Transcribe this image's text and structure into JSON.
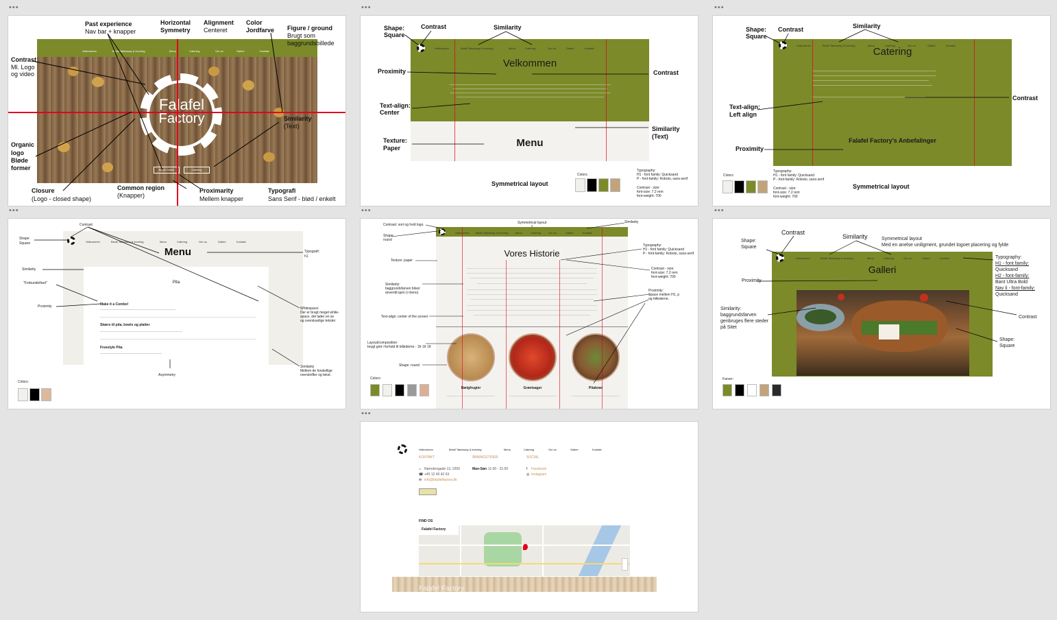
{
  "board": {
    "background": "#e4e4e4",
    "frame_menu": "•••"
  },
  "colors": {
    "olive": "#7c8a2a",
    "white": "#ffffff",
    "offwhite": "#f1f0ec",
    "black": "#000000",
    "tan": "#c2a37b",
    "grey": "#9a9a9a",
    "peach": "#dcae98",
    "dark": "#2a2a2a",
    "red": "#e2001a"
  },
  "frame1": {
    "past_experience_title": "Past experience",
    "past_experience_sub": "Nav bar + knapper",
    "horizontal_title": "Horizontal",
    "horizontal_sub": "Symmetry",
    "alignment_title": "Alignment",
    "alignment_sub": "Centeret",
    "color_title": "Color",
    "color_sub": "Jordfarve",
    "figure_title": "Figure / ground",
    "figure_sub1": "Brugt som",
    "figure_sub2": "baggrundsbillede",
    "contrast_title": "Contrast",
    "contrast_sub1": "Ml. Logo",
    "contrast_sub2": "og video",
    "organic_1": "Organic",
    "organic_2": "logo",
    "organic_3": "Bløde",
    "organic_4": "former",
    "similarity_title": "Similarity",
    "similarity_sub": "(Text)",
    "closure_title": "Closure",
    "closure_sub": "(Logo  - closed shape)",
    "common_title": "Common region",
    "common_sub": "(Knapper)",
    "proximity_title": "Proximarity",
    "proximity_sub": "Mellem knapper",
    "typografi_title": "Typografi",
    "typografi_sub": "Sans Serif - blød / enkelt",
    "nav": [
      "Velkommen",
      "Bestil Takeaway & levering",
      "Menu",
      "Catering",
      "Om os",
      "Galleri",
      "Kontakt"
    ],
    "logo_line1": "Falafel",
    "logo_line2": "Factory",
    "btn_left": "Bestil Online",
    "btn_right": "Catering"
  },
  "frame2": {
    "shape": "Shape:",
    "square": "Square",
    "contrast": "Contrast",
    "similarity": "Similarity",
    "proximity": "Proximity",
    "contrast_right": "Contrast",
    "text_align": "Text-align:",
    "center": "Center",
    "similarity_text1": "Similarity",
    "similarity_text2": "(Text)",
    "texture": "Texture:",
    "paper": "Paper",
    "heading": "Velkommen",
    "menu_heading": "Menu",
    "symmetrical": "Symmetrical layout",
    "colors_label": "Colors:",
    "typo_1": "Typography:",
    "typo_2": "H1 - font family: Quicksand",
    "typo_3": "P - font-family: Roboto, sans-serif",
    "typo_4": "Contrast - size:",
    "typo_5": "font-size: 7.2 rem",
    "typo_6": "font-weight: 700"
  },
  "frame3": {
    "shape": "Shape:",
    "square": "Square",
    "contrast": "Contrast",
    "similarity": "Similarity",
    "heading": "Catering",
    "contrast_right": "Contrast",
    "text_align": "Text-align:",
    "left_align": "Left align",
    "proximity": "Proximity",
    "sub_heading": "Falafel Factory's Anbefalinger",
    "colors_label": "Colors:",
    "symmetrical": "Symmetrical layout",
    "typo_1": "Typography:",
    "typo_2": "H1 - font family: Quicksand",
    "typo_3": "P - font-family: Roboto, sans-serif",
    "typo_4": "Contrast - size:",
    "typo_5": "font-size: 7.2 rem",
    "typo_6": "font-weight: 700"
  },
  "frame4": {
    "contrast": "Contrast",
    "shape": "Shape:",
    "square": "Square",
    "heading": "Menu",
    "typografi": "Typografi:",
    "h1": "h1",
    "similarity": "Similarity",
    "forbundethed": "\"Forbundethed\"",
    "proximity": "Proximity",
    "pita": "Pita",
    "item1": "Make it a Combo!",
    "item2": "Skærs til pita, bowls og platter",
    "item3": "Freestyle Pita",
    "whitespace_1": "Whitespace:",
    "whitespace_2": "Der er brugt meget white-",
    "whitespace_3": "space, det lader en se",
    "whitespace_4": "og overskuelige tekster",
    "similarity_2": "Similarity",
    "similarity_3": "Mellem de forskellige",
    "similarity_4": "overskrifter og tekst.",
    "asymmetry": "Asymmetry",
    "colors_label": "Colors:"
  },
  "frame5": {
    "contrast": "Contrast: sort og hvid logo.",
    "symmetrical": "Symmetrical layout",
    "similarity": "Similarity",
    "shape": "Shape:",
    "round": "round",
    "heading": "Vores Historie",
    "typo_1": "Typography:",
    "typo_2": "H1 - font family: Quicksand",
    "typo_3": "P - font-family: Roboto, sans-serif",
    "texture": "Texture: paper",
    "contrast_size_1": "Contrast - size:",
    "contrast_size_2": "font-size: 7.2 rem",
    "contrast_size_3": "font-weight: 700",
    "similarity_bg_1": "Similarity:",
    "similarity_bg_2": "baggrundsfarven bliver",
    "similarity_bg_3": "anvendt igen (i menu)",
    "proximity_1": "Proximity:",
    "proximity_2": "Space mellem H1, p",
    "proximity_3": "og billederne.",
    "text_align": "Text-align: center of the screen",
    "layout_1": "Layout/composition:",
    "layout_2": "brugt grid i forhold til billederne - 1fr 1fr 1fr",
    "shape_round": "Shape: round",
    "colors_label": "Colors:",
    "circle1": "Bælgfrugter",
    "circle2": "Grøntsager",
    "circle3": "Pitabrød"
  },
  "frame6": {
    "contrast": "Contrast",
    "similarity": "Similarity",
    "sym_1": "Symmetrical layout",
    "sym_2": "Med en anelse uniligment, grundet logoet placering og fylde",
    "shape": "Shape:",
    "square": "Square",
    "heading": "Galleri",
    "typo_1": "Typography:",
    "typo_2": "H1 - font family:",
    "typo_3": "Quicksand",
    "typo_4": "H2 - font-family:",
    "typo_5": "Bant Ultra Bold",
    "typo_6": "Nav li - font-family:",
    "typo_7": "Quicksand",
    "proximity": "Proximity",
    "similarity_1": "Similarity:",
    "similarity_2": "baggrundsfarven",
    "similarity_3": "genbruges flere steder",
    "similarity_4": "på Sitet",
    "contrast_right": "Contrast",
    "shape2": "Shape:",
    "square2": "Square",
    "colors_label": "Farver:"
  },
  "frame7": {
    "nav": [
      "Velkommen",
      "Bestil Takeaway & levering",
      "Menu",
      "Catering",
      "Om os",
      "Galleri",
      "Kontakt"
    ],
    "kontakt": "KONTAKT",
    "abning": "ÅBNINGSTIDER",
    "social": "SOCIAL",
    "address": "Nørrebrogade 13, 2200",
    "phone": "+45 12 40 42 63",
    "email": "info@falafelfactory.dk",
    "hours_day": "Man-Søn",
    "hours_time": "11:00 - 21:00",
    "facebook": "Facebook",
    "instagram": "Instagram",
    "find_os": "FIND OS",
    "map_title": "Falafel Factory",
    "footer_logo": "Falafel Factory"
  }
}
